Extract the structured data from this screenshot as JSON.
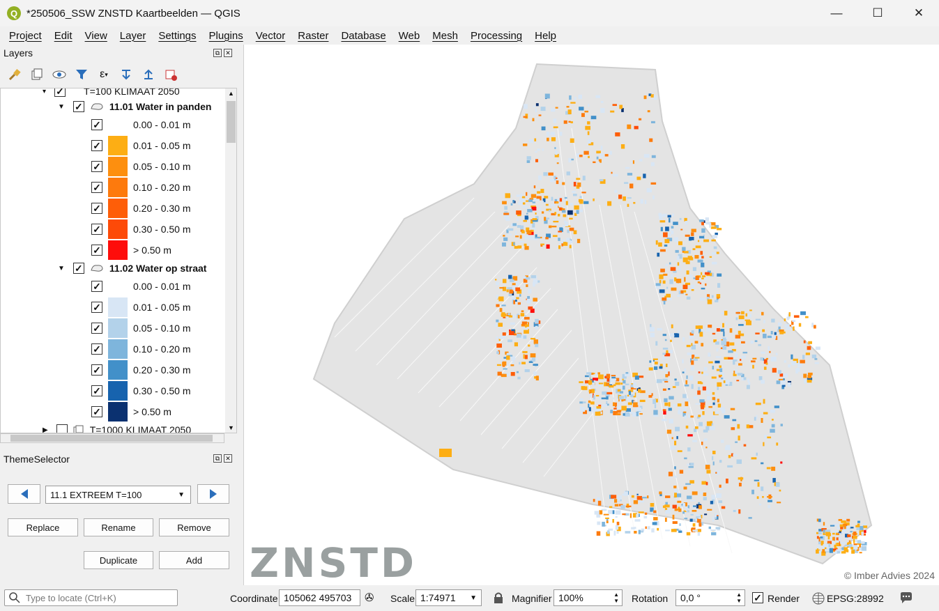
{
  "window": {
    "title": "*250506_SSW ZNSTD Kaartbeelden — QGIS",
    "minimize": "—",
    "maximize": "☐",
    "close": "✕"
  },
  "menu": [
    "Project",
    "Edit",
    "View",
    "Layer",
    "Settings",
    "Plugins",
    "Vector",
    "Raster",
    "Database",
    "Web",
    "Mesh",
    "Processing",
    "Help"
  ],
  "layers_panel": {
    "title": "Layers",
    "group_top": "T=100 KLIMAAT 2050",
    "layer1": {
      "name": "11.01 Water in panden",
      "classes": [
        {
          "label": "0.00 - 0.01 m",
          "color": ""
        },
        {
          "label": "0.01 - 0.05 m",
          "color": "#fdae14"
        },
        {
          "label": "0.05 - 0.10 m",
          "color": "#fd8f0f"
        },
        {
          "label": "0.10 - 0.20 m",
          "color": "#fd7a0d"
        },
        {
          "label": "0.20 - 0.30 m",
          "color": "#fe5e08"
        },
        {
          "label": "0.30 - 0.50 m",
          "color": "#fd4a08"
        },
        {
          "label": "> 0.50 m",
          "color": "#fe0d0b"
        }
      ]
    },
    "layer2": {
      "name": "11.02 Water op straat",
      "classes": [
        {
          "label": "0.00 - 0.01 m",
          "color": ""
        },
        {
          "label": "0.01 - 0.05 m",
          "color": "#d8e6f5"
        },
        {
          "label": "0.05 - 0.10 m",
          "color": "#b3d2ea"
        },
        {
          "label": "0.10 - 0.20 m",
          "color": "#7eb5dc"
        },
        {
          "label": "0.20 - 0.30 m",
          "color": "#4290c9"
        },
        {
          "label": "0.30 - 0.50 m",
          "color": "#1763ae"
        },
        {
          "label": "> 0.50 m",
          "color": "#0b3170"
        }
      ]
    },
    "group_bottom": "T=1000 KLIMAAT 2050"
  },
  "theme_selector": {
    "title": "ThemeSelector",
    "selected": "11.1 EXTREEM T=100",
    "buttons": {
      "replace": "Replace",
      "rename": "Rename",
      "remove": "Remove",
      "duplicate": "Duplicate",
      "add": "Add"
    }
  },
  "map": {
    "logo": "ZNSTD",
    "copyright": "© Imber Advies 2024"
  },
  "status": {
    "search_placeholder": "Type to locate (Ctrl+K)",
    "coordinate_label": "Coordinate",
    "coordinate": "105062  495703",
    "scale_label": "Scale",
    "scale": "1:74971",
    "magnifier_label": "Magnifier",
    "magnifier": "100%",
    "rotation_label": "Rotation",
    "rotation": "0,0 °",
    "render_label": "Render",
    "crs": "EPSG:28992"
  }
}
